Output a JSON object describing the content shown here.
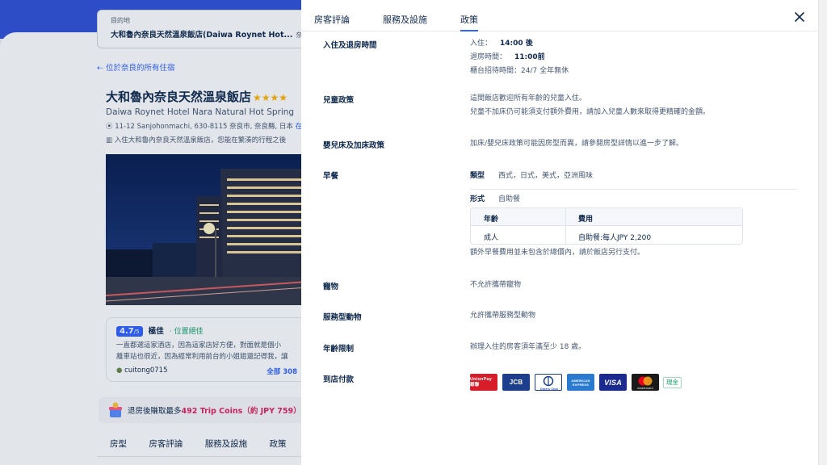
{
  "background": {
    "destination": {
      "label": "目的地",
      "value": "大和魯內奈良天然溫泉飯店(Daiwa Roynet Hot...",
      "suffix": "奈良"
    },
    "back_link": "位於奈良的所有住宿",
    "hotel": {
      "name": "大和魯內奈良天然溫泉飯店",
      "stars": "★★★★",
      "name_en": "Daiwa Roynet Hotel Nara Natural Hot Spring",
      "address": "11-12 Sanjohonmachi, 630-8115 奈良市, 奈良縣, 日本",
      "map_link": "在地",
      "description": "入住大和魯內奈良天然溫泉飯店，您能在繁湊的行程之後"
    },
    "review": {
      "score": "4.7",
      "score_max": "/5",
      "rating_word": "極佳",
      "rating_tag": "· 位置絕佳",
      "text_line1": "一直都選這家酒店，因為這家店好方便，對面就是個小",
      "text_line2": "離車站也很近，因為經常利用前台的小姐姐還記得我，讓",
      "user": "cuitong0715",
      "all_reviews": "全部 308"
    },
    "coins": {
      "prefix": "退房後賺取最多",
      "amount": "492 Trip Coins",
      "approx": "（約 JPY 759）"
    },
    "tabs": [
      "房型",
      "房客評論",
      "服務及設施",
      "政策"
    ]
  },
  "panel": {
    "tabs": [
      {
        "label": "房客評論"
      },
      {
        "label": "服務及設施"
      },
      {
        "label": "政策"
      }
    ],
    "active_tab": "政策",
    "sections": {
      "checkin": {
        "title": "入住及退房時間",
        "checkin_label": "入住：",
        "checkin_value": "14:00 後",
        "checkout_label": "退房時間：",
        "checkout_value": "11:00前",
        "front_desk": "櫃台招待時間：24/7 全年無休"
      },
      "children": {
        "title": "兒童政策",
        "line1": "這間飯店歡迎所有年齡的兒童入住。",
        "line2": "兒童不加床仍可能須支付額外費用，請加入兒童人數來取得更精確的金額。"
      },
      "beds": {
        "title": "嬰兒床及加床政策",
        "text": "加床/嬰兒床政策可能因房型而異，請參閱房型詳情以進一步了解。"
      },
      "breakfast": {
        "title": "早餐",
        "type_label": "類型",
        "type_value": "西式，日式，美式，亞洲風味",
        "format_label": "形式",
        "format_value": "自助餐",
        "table_headers": [
          "年齡",
          "費用"
        ],
        "table_rows": [
          [
            "成人",
            "自助餐:每人JPY 2,200"
          ]
        ],
        "note": "額外早餐費用並未包含於總價內，請於飯店另行支付。"
      },
      "pets": {
        "title": "寵物",
        "text": "不允許攜帶寵物"
      },
      "service_animals": {
        "title": "服務型動物",
        "text": "允許攜帶服務型動物"
      },
      "age": {
        "title": "年齡限制",
        "text": "辦理入住的房客須年滿至少 18 歲。"
      },
      "payment": {
        "title": "到店付款",
        "cards": [
          {
            "name": "unionpay-card-icon",
            "text": "UnionPay 銀聯",
            "color": "#d71d2a"
          },
          {
            "name": "jcb-card-icon",
            "text": "JCB",
            "color": "#1d3e8c"
          },
          {
            "name": "diners-club-card-icon",
            "text": "Diners Club",
            "color": "#ffffff"
          },
          {
            "name": "amex-card-icon",
            "text": "AMERICAN EXPRESS",
            "color": "#2a7ad0"
          },
          {
            "name": "visa-card-icon",
            "text": "VISA",
            "color": "#1a2a8f"
          },
          {
            "name": "mastercard-card-icon",
            "text": "mastercard",
            "color": "#1a1a1a"
          }
        ],
        "cash": "現金"
      }
    }
  },
  "colors": {
    "accent": "#3264ff",
    "brand_blue": "#3053d8",
    "green": "#15a36e",
    "coins_red": "#e0245e"
  }
}
